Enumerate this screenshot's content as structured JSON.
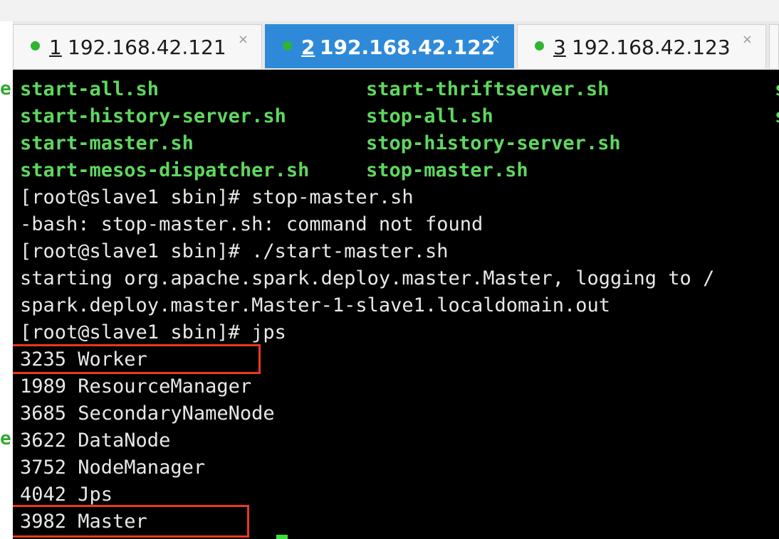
{
  "tabs": [
    {
      "number": "1",
      "host": "192.168.42.121",
      "active": false
    },
    {
      "number": "2",
      "host": "192.168.42.122",
      "active": true
    },
    {
      "number": "3",
      "host": "192.168.42.123",
      "active": false
    }
  ],
  "tab_close_glyph": "×",
  "gutter_marks": [
    "e",
    "e"
  ],
  "terminal": {
    "ls_listing": [
      [
        "start-all.sh",
        "start-thriftserver.sh"
      ],
      [
        "start-history-server.sh",
        "stop-all.sh"
      ],
      [
        "start-master.sh",
        "stop-history-server.sh"
      ],
      [
        "start-mesos-dispatcher.sh",
        "stop-master.sh"
      ]
    ],
    "overflow_marks": [
      "s",
      "s"
    ],
    "lines": [
      "[root@slave1 sbin]# stop-master.sh",
      "-bash: stop-master.sh: command not found",
      "[root@slave1 sbin]# ./start-master.sh",
      "starting org.apache.spark.deploy.master.Master, logging to /",
      "spark.deploy.master.Master-1-slave1.localdomain.out",
      "[root@slave1 sbin]# jps",
      "3235 Worker",
      "1989 ResourceManager",
      "3685 SecondaryNameNode",
      "3622 DataNode",
      "3752 NodeManager",
      "4042 Jps",
      "3982 Master"
    ]
  },
  "colors": {
    "terminal_bg": "#000000",
    "terminal_fg": "#e8e8e8",
    "ls_green": "#5fd75f",
    "tab_active": "#2e8ad8",
    "status_dot": "#2fb52f",
    "highlight_box": "#e8391d"
  }
}
